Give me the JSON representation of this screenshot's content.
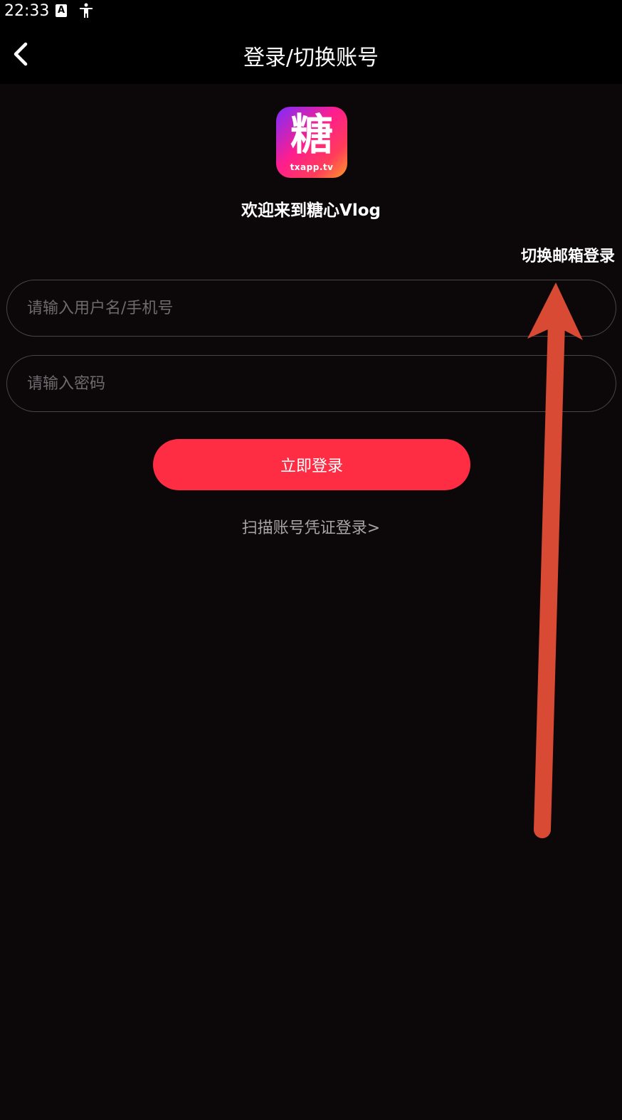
{
  "status_bar": {
    "time": "22:33",
    "a_badge": "A"
  },
  "header": {
    "title": "登录/切换账号"
  },
  "logo": {
    "glyph": "糖",
    "subtitle": "txapp.tv"
  },
  "welcome_text": "欢迎来到糖心Vlog",
  "switch_email_label": "切换邮箱登录",
  "username_input": {
    "placeholder": "请输入用户名/手机号",
    "value": ""
  },
  "password_input": {
    "placeholder": "请输入密码",
    "value": ""
  },
  "login_button_label": "立即登录",
  "scan_link_label": "扫描账号凭证登录>",
  "colors": {
    "background": "#0c0709",
    "accent": "#ff2d44",
    "annotation": "#d84a33"
  }
}
